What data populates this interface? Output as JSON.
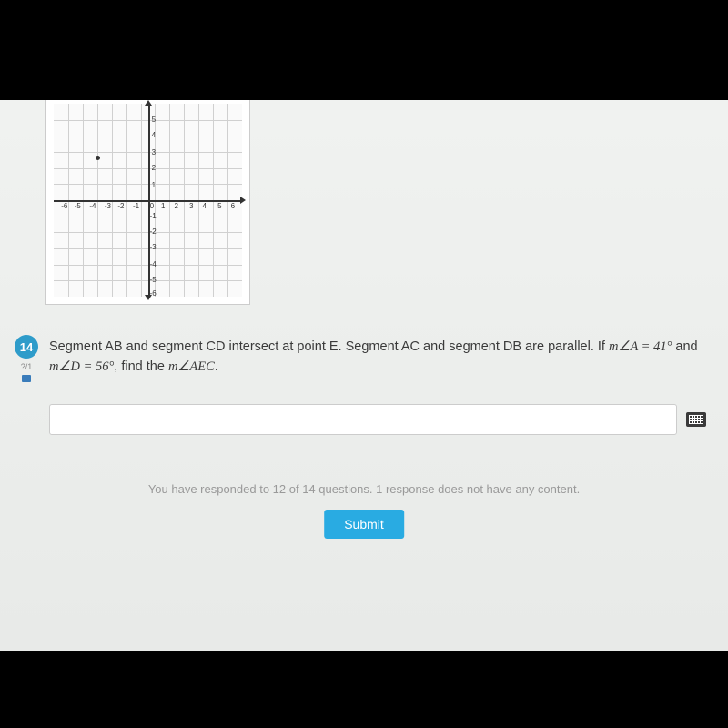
{
  "question": {
    "number": "14",
    "points": "?/1",
    "text_part1": "Segment AB and segment CD intersect at point E.  Segment AC and segment DB are parallel.  If ",
    "math1": "m∠A = 41°",
    "text_part2": " and ",
    "math2": "m∠D = 56°",
    "text_part3": ", find the ",
    "math3": "m∠AEC",
    "text_part4": "."
  },
  "graph": {
    "x_ticks": [
      "-6",
      "-5",
      "-4",
      "-3",
      "-2",
      "-1",
      "0",
      "1",
      "2",
      "3",
      "4",
      "5",
      "6"
    ],
    "y_ticks_pos": [
      "1",
      "2",
      "3",
      "4",
      "5"
    ],
    "y_ticks_neg": [
      "-1",
      "-2",
      "-3",
      "-4",
      "-5",
      "-6"
    ]
  },
  "answer_input": {
    "value": "",
    "placeholder": ""
  },
  "status": "You have responded to 12 of 14 questions. 1 response does not have any content.",
  "submit_label": "Submit"
}
